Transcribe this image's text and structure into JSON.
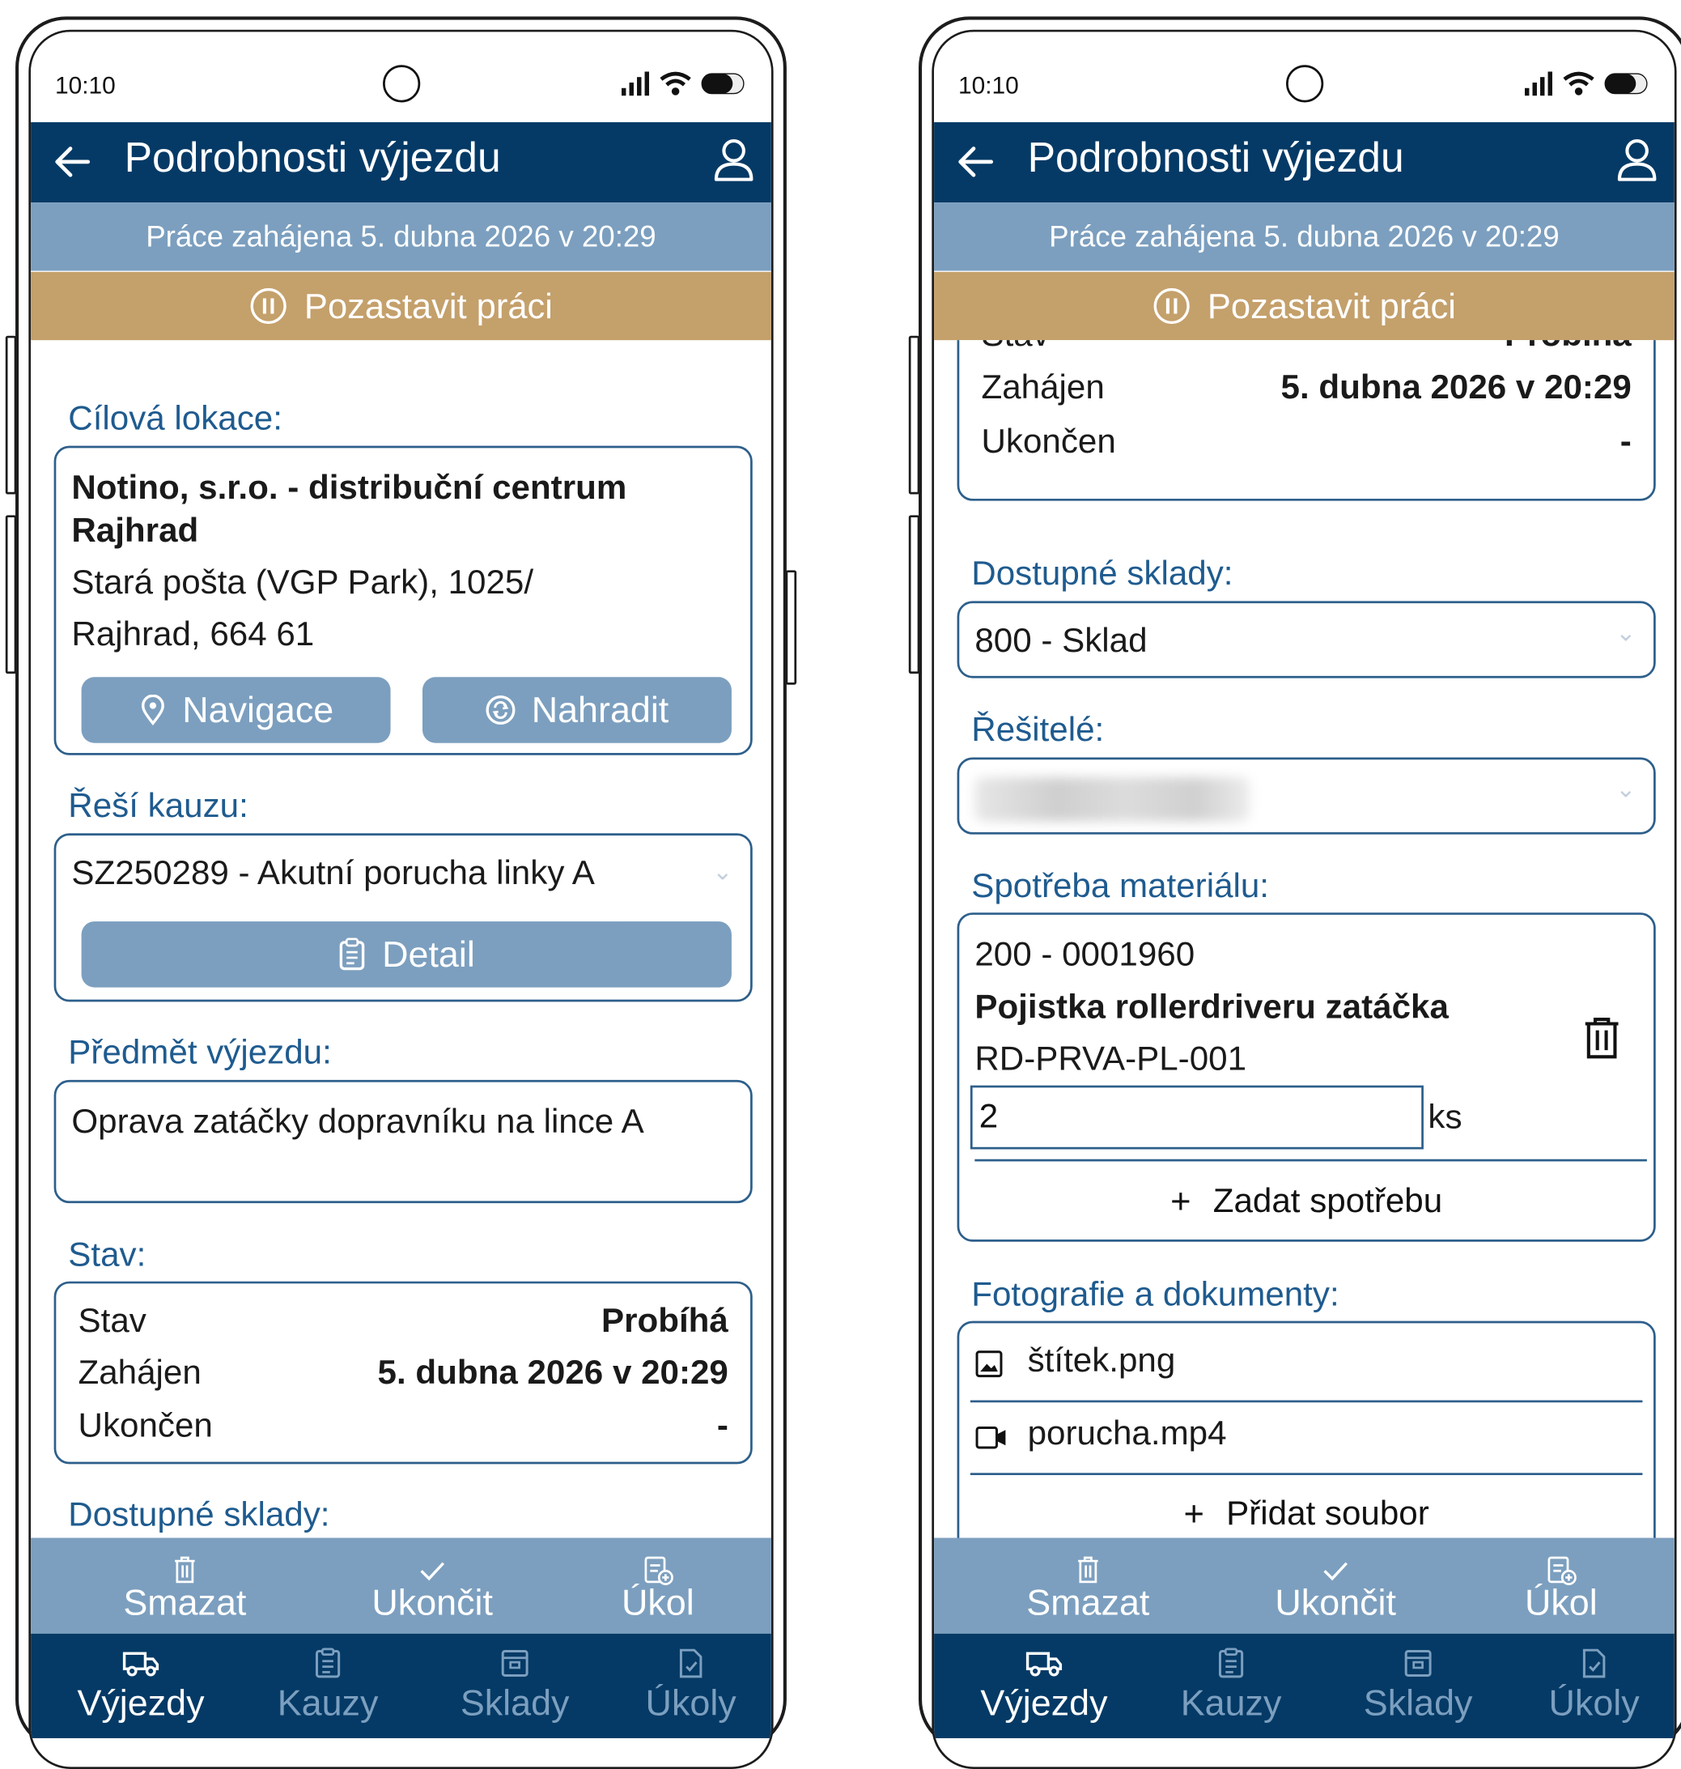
{
  "status": {
    "time": "10:10"
  },
  "header": {
    "title": "Podrobnosti výjezdu"
  },
  "banner": {
    "text": "Práce zahájena 5. dubna 2026 v 20:29"
  },
  "pause": {
    "label": "Pozastavit práci"
  },
  "location": {
    "label": "Cílová lokace:",
    "name_line1": "Notino, s.r.o. - distribuční centrum",
    "name_line2": "Rajhrad",
    "address_line1": "Stará pošta (VGP Park), 1025/",
    "address_line2": "Rajhrad, 664 61",
    "navigate_label": "Navigace",
    "replace_label": "Nahradit"
  },
  "case": {
    "label": "Řeší kauzu:",
    "value": "SZ250289 - Akutní porucha linky A",
    "detail_label": "Detail"
  },
  "subject": {
    "label": "Předmět výjezdu:",
    "value": "Oprava zatáčky dopravníku na lince A"
  },
  "state": {
    "label": "Stav:",
    "rows": [
      {
        "key": "Stav",
        "value": "Probíhá"
      },
      {
        "key": "Zahájen",
        "value": "5. dubna 2026 v 20:29"
      },
      {
        "key": "Ukončen",
        "value": "-"
      }
    ]
  },
  "warehouses": {
    "label": "Dostupné sklady:",
    "value": "800 - Sklad"
  },
  "solvers": {
    "label": "Řešitelé:"
  },
  "materials": {
    "label": "Spotřeba materiálu:",
    "item": {
      "code": "200 - 0001960",
      "name": "Pojistka rollerdriveru zatáčka",
      "sku": "RD-PRVA-PL-001",
      "qty": "2",
      "unit": "ks"
    },
    "add_label": "Zadat spotřebu"
  },
  "files": {
    "label": "Fotografie a dokumenty:",
    "items": [
      {
        "name": "štítek.png",
        "icon": "image-icon"
      },
      {
        "name": "porucha.mp4",
        "icon": "video-icon"
      }
    ],
    "add_label": "Přidat soubor"
  },
  "actions": [
    {
      "label": "Smazat",
      "icon": "trash-icon"
    },
    {
      "label": "Ukončit",
      "icon": "check-icon"
    },
    {
      "label": "Úkol",
      "icon": "task-add-icon"
    }
  ],
  "nav": [
    {
      "label": "Výjezdy",
      "icon": "truck-icon",
      "active": true
    },
    {
      "label": "Kauzy",
      "icon": "clipboard-icon",
      "active": false
    },
    {
      "label": "Sklady",
      "icon": "warehouse-icon",
      "active": false
    },
    {
      "label": "Úkoly",
      "icon": "task-doc-icon",
      "active": false
    }
  ],
  "colors": {
    "primary": "#053a66",
    "secondary": "#7c9fbf",
    "pause": "#c4a06b",
    "label": "#1f5b8f"
  }
}
